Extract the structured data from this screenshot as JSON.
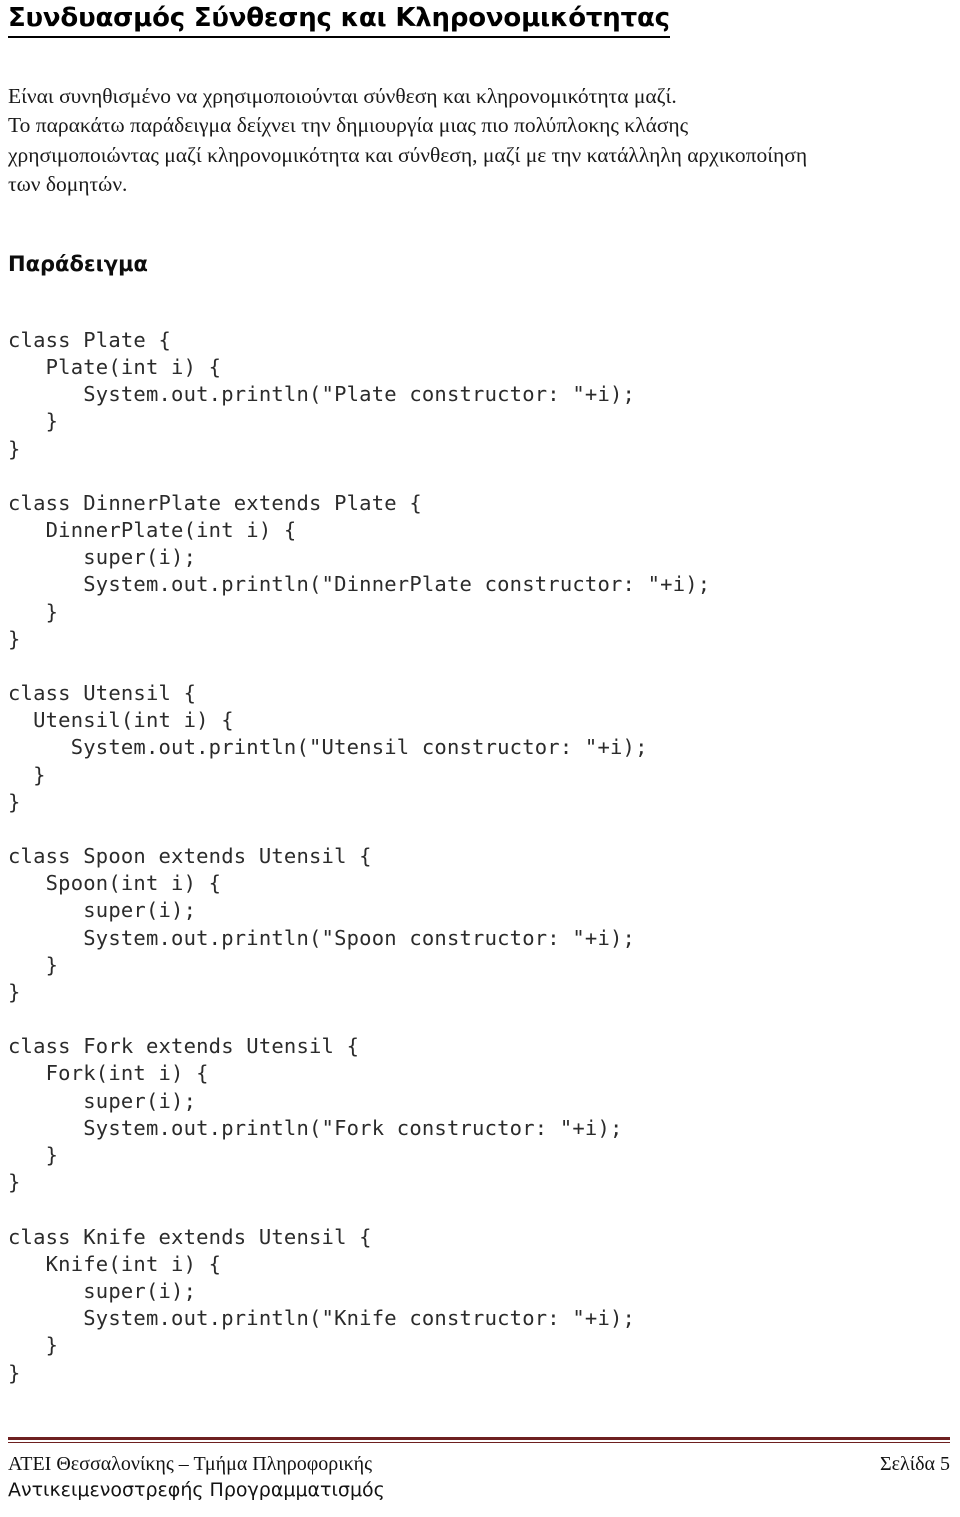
{
  "document": {
    "title": "Συνδυασμός Σύνθεσης και Κληρονομικότητας",
    "intro": {
      "line1": "Είναι συνηθισμένο να χρησιμοποιούνται σύνθεση και κληρονομικότητα μαζί.",
      "line2": "Το παρακάτω παράδειγμα δείχνει την δημιουργία μιας πιο πολύπλοκης κλάσης",
      "line3": "χρησιμοποιώντας μαζί κληρονομικότητα και σύνθεση, μαζί με την κατάλληλη αρχικοποίηση",
      "line4": "των δομητών."
    },
    "example_heading": "Παράδειγμα",
    "code_blocks": {
      "plate": "class Plate {\n   Plate(int i) {\n      System.out.println(\"Plate constructor: \"+i);\n   }\n}",
      "dinner_plate": "class DinnerPlate extends Plate {\n   DinnerPlate(int i) {\n      super(i);\n      System.out.println(\"DinnerPlate constructor: \"+i);\n   }\n}",
      "utensil": "class Utensil {\n  Utensil(int i) {\n     System.out.println(\"Utensil constructor: \"+i);\n  }\n}",
      "spoon": "class Spoon extends Utensil {\n   Spoon(int i) {\n      super(i);\n      System.out.println(\"Spoon constructor: \"+i);\n   }\n}",
      "fork": "class Fork extends Utensil {\n   Fork(int i) {\n      super(i);\n      System.out.println(\"Fork constructor: \"+i);\n   }\n}",
      "knife": "class Knife extends Utensil {\n   Knife(int i) {\n      super(i);\n      System.out.println(\"Knife constructor: \"+i);\n   }\n}"
    },
    "footer": {
      "institution": "ΑΤΕΙ Θεσσαλονίκης – Τμήμα Πληροφορικής",
      "course": "Αντικειμενοστρεφής Προγραμματισμός",
      "page_label": "Σελίδα 5",
      "rule_color": "#6e2020"
    }
  }
}
